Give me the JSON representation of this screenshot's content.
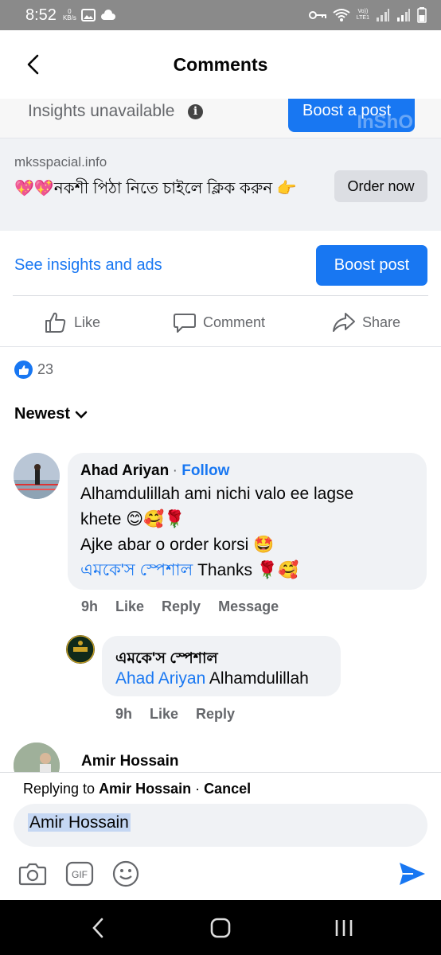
{
  "status": {
    "time": "8:52",
    "kbs_value": "0",
    "kbs_unit": "KB/s",
    "volte_top": "Vo))",
    "volte_bottom": "LTE1"
  },
  "header": {
    "title": "Comments"
  },
  "insights_strip": {
    "text": "Insights unavailable",
    "button": "Boost a post",
    "watermark": "InShO"
  },
  "ad": {
    "domain": "mksspacial.info",
    "headline": "💖💖নকশী পিঠা নিতে চাইলে ক্লিক করুন 👉",
    "cta": "Order now"
  },
  "actions": {
    "see_insights": "See insights and ads",
    "boost_post": "Boost post"
  },
  "reactbar": {
    "like": "Like",
    "comment": "Comment",
    "share": "Share"
  },
  "reactions": {
    "count": "23"
  },
  "sort": {
    "label": "Newest"
  },
  "comments": [
    {
      "author": "Ahad Ariyan",
      "follow": "Follow",
      "lines": [
        "Alhamdulillah ami nichi valo ee lagse",
        "khete 😊🥰🌹",
        "Ajke abar o order korsi 🤩"
      ],
      "mention": "এমকে'স স্পেশাল",
      "last": " Thanks 🌹🥰",
      "time": "9h",
      "like": "Like",
      "reply": "Reply",
      "message": "Message"
    },
    {
      "author": "এমকে'স স্পেশাল",
      "mention": "Ahad Ariyan",
      "text": " Alhamdulillah",
      "time": "9h",
      "like": "Like",
      "reply": "Reply"
    },
    {
      "author": "Amir Hossain"
    }
  ],
  "reply_bar": {
    "prefix": "Replying to ",
    "name": "Amir Hossain",
    "separator": " · ",
    "cancel": "Cancel",
    "input_value": "Amir Hossain"
  },
  "colors": {
    "brand": "#1877f2",
    "bubble": "#f0f2f5",
    "muted": "#65676b"
  }
}
